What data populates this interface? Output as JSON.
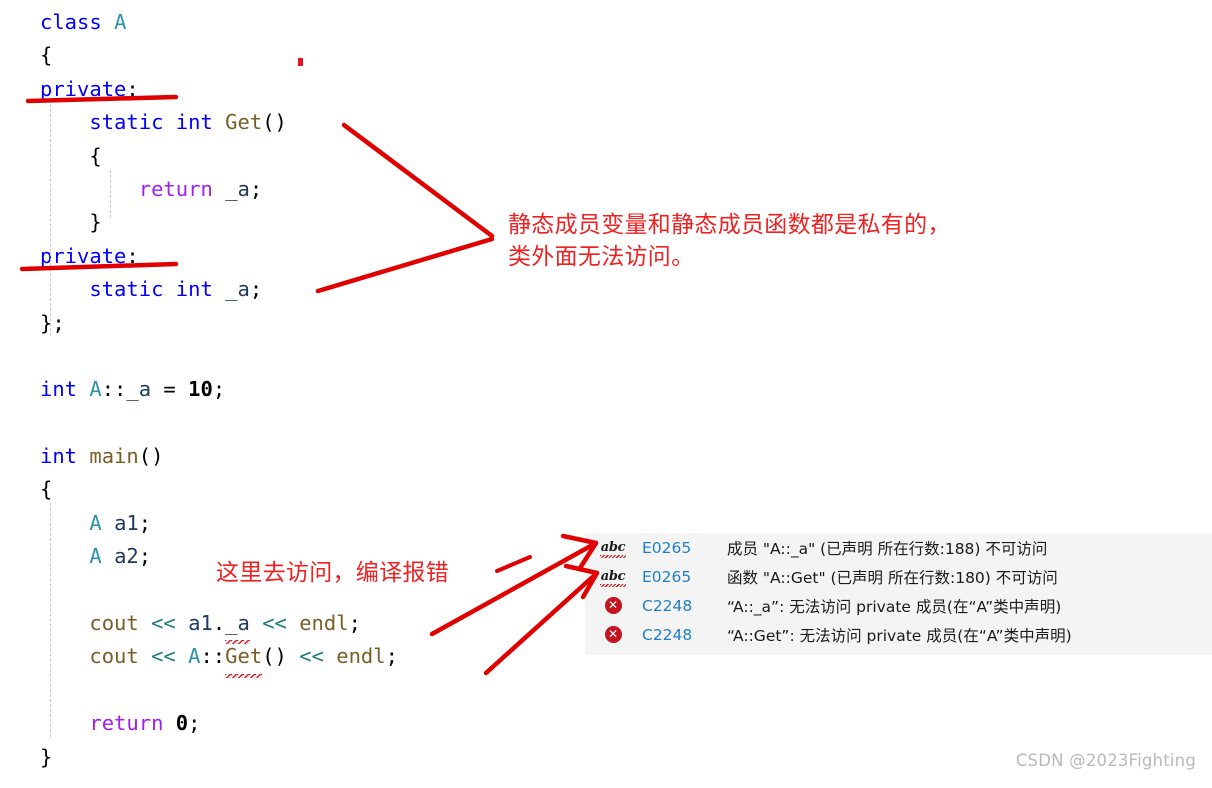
{
  "editor": {
    "lines": [
      {
        "id": "l1",
        "tokens": [
          {
            "t": "class",
            "c": "kw"
          },
          {
            "t": " ",
            "c": "punc"
          },
          {
            "t": "A",
            "c": "type"
          }
        ]
      },
      {
        "id": "l2",
        "tokens": [
          {
            "t": "{",
            "c": "punc"
          }
        ]
      },
      {
        "id": "l3",
        "tokens": [
          {
            "t": "private",
            "c": "kw"
          },
          {
            "t": ":",
            "c": "punc"
          }
        ]
      },
      {
        "id": "l4",
        "tokens": [
          {
            "t": "    ",
            "c": "punc"
          },
          {
            "t": "static",
            "c": "kw"
          },
          {
            "t": " ",
            "c": "punc"
          },
          {
            "t": "int",
            "c": "kw"
          },
          {
            "t": " ",
            "c": "punc"
          },
          {
            "t": "Get",
            "c": "fn"
          },
          {
            "t": "()",
            "c": "punc"
          }
        ]
      },
      {
        "id": "l5",
        "tokens": [
          {
            "t": "    {",
            "c": "punc"
          }
        ]
      },
      {
        "id": "l6",
        "tokens": [
          {
            "t": "        ",
            "c": "punc"
          },
          {
            "t": "return",
            "c": "ctl"
          },
          {
            "t": " ",
            "c": "punc"
          },
          {
            "t": "_a",
            "c": "ident"
          },
          {
            "t": ";",
            "c": "punc"
          }
        ]
      },
      {
        "id": "l7",
        "tokens": [
          {
            "t": "    }",
            "c": "punc"
          }
        ]
      },
      {
        "id": "l8",
        "tokens": [
          {
            "t": "private",
            "c": "kw"
          },
          {
            "t": ":",
            "c": "punc"
          }
        ]
      },
      {
        "id": "l9",
        "tokens": [
          {
            "t": "    ",
            "c": "punc"
          },
          {
            "t": "static",
            "c": "kw"
          },
          {
            "t": " ",
            "c": "punc"
          },
          {
            "t": "int",
            "c": "kw"
          },
          {
            "t": " ",
            "c": "punc"
          },
          {
            "t": "_a",
            "c": "ident"
          },
          {
            "t": ";",
            "c": "punc"
          }
        ]
      },
      {
        "id": "l10",
        "tokens": [
          {
            "t": "};",
            "c": "punc"
          }
        ]
      },
      {
        "id": "l11",
        "tokens": []
      },
      {
        "id": "l12",
        "tokens": [
          {
            "t": "int",
            "c": "kw"
          },
          {
            "t": " ",
            "c": "punc"
          },
          {
            "t": "A",
            "c": "type"
          },
          {
            "t": "::",
            "c": "punc"
          },
          {
            "t": "_a",
            "c": "ident"
          },
          {
            "t": " = ",
            "c": "punc"
          },
          {
            "t": "10",
            "c": "num"
          },
          {
            "t": ";",
            "c": "punc"
          }
        ]
      },
      {
        "id": "l13",
        "tokens": []
      },
      {
        "id": "l14",
        "tokens": [
          {
            "t": "int",
            "c": "kw"
          },
          {
            "t": " ",
            "c": "punc"
          },
          {
            "t": "main",
            "c": "fn"
          },
          {
            "t": "()",
            "c": "punc"
          }
        ]
      },
      {
        "id": "l15",
        "tokens": [
          {
            "t": "{",
            "c": "punc"
          }
        ]
      },
      {
        "id": "l16",
        "tokens": [
          {
            "t": "    ",
            "c": "punc"
          },
          {
            "t": "A",
            "c": "type"
          },
          {
            "t": " ",
            "c": "punc"
          },
          {
            "t": "a1",
            "c": "ident"
          },
          {
            "t": ";",
            "c": "punc"
          }
        ]
      },
      {
        "id": "l17",
        "tokens": [
          {
            "t": "    ",
            "c": "punc"
          },
          {
            "t": "A",
            "c": "type"
          },
          {
            "t": " ",
            "c": "punc"
          },
          {
            "t": "a2",
            "c": "ident"
          },
          {
            "t": ";",
            "c": "punc"
          }
        ]
      },
      {
        "id": "l18",
        "tokens": []
      },
      {
        "id": "l19",
        "tokens": [
          {
            "t": "    ",
            "c": "punc"
          },
          {
            "t": "cout",
            "c": "fn"
          },
          {
            "t": " ",
            "c": "punc"
          },
          {
            "t": "<<",
            "c": "op"
          },
          {
            "t": " ",
            "c": "punc"
          },
          {
            "t": "a1",
            "c": "ident"
          },
          {
            "t": ".",
            "c": "punc"
          },
          {
            "t": "_a",
            "c": "ident",
            "err": true
          },
          {
            "t": " ",
            "c": "punc"
          },
          {
            "t": "<<",
            "c": "op"
          },
          {
            "t": " ",
            "c": "punc"
          },
          {
            "t": "endl",
            "c": "fn"
          },
          {
            "t": ";",
            "c": "punc"
          }
        ]
      },
      {
        "id": "l20",
        "tokens": [
          {
            "t": "    ",
            "c": "punc"
          },
          {
            "t": "cout",
            "c": "fn"
          },
          {
            "t": " ",
            "c": "punc"
          },
          {
            "t": "<<",
            "c": "op"
          },
          {
            "t": " ",
            "c": "punc"
          },
          {
            "t": "A",
            "c": "type"
          },
          {
            "t": "::",
            "c": "punc"
          },
          {
            "t": "Get",
            "c": "fn",
            "err": true
          },
          {
            "t": "()",
            "c": "punc"
          },
          {
            "t": " ",
            "c": "punc"
          },
          {
            "t": "<<",
            "c": "op"
          },
          {
            "t": " ",
            "c": "punc"
          },
          {
            "t": "endl",
            "c": "fn"
          },
          {
            "t": ";",
            "c": "punc"
          }
        ]
      },
      {
        "id": "l21",
        "tokens": []
      },
      {
        "id": "l22",
        "tokens": [
          {
            "t": "    ",
            "c": "punc"
          },
          {
            "t": "return",
            "c": "ctl"
          },
          {
            "t": " ",
            "c": "punc"
          },
          {
            "t": "0",
            "c": "num"
          },
          {
            "t": ";",
            "c": "punc"
          }
        ]
      },
      {
        "id": "l23",
        "tokens": [
          {
            "t": "}",
            "c": "punc"
          }
        ]
      }
    ]
  },
  "annotations": {
    "accent_color": "#ee2222",
    "note_private": "静态成员变量和静态成员函数都是私有的，\n类外面无法访问。",
    "note_access": "这里去访问，编译报错"
  },
  "errors": {
    "rows": [
      {
        "icon": "intellisense-abc-icon",
        "icon_glyph": "abc",
        "code": "E0265",
        "message": "成员 \"A::_a\" (已声明 所在行数:188) 不可访问"
      },
      {
        "icon": "intellisense-abc-icon",
        "icon_glyph": "abc",
        "code": "E0265",
        "message": "函数 \"A::Get\" (已声明 所在行数:180) 不可访问"
      },
      {
        "icon": "error-x-icon",
        "icon_glyph": "✕",
        "code": "C2248",
        "message": "“A::_a”: 无法访问 private 成员(在“A”类中声明)"
      },
      {
        "icon": "error-x-icon",
        "icon_glyph": "✕",
        "code": "C2248",
        "message": "“A::Get”: 无法访问 private 成员(在“A”类中声明)"
      }
    ]
  },
  "watermark": {
    "text": "CSDN @2023Fighting"
  }
}
